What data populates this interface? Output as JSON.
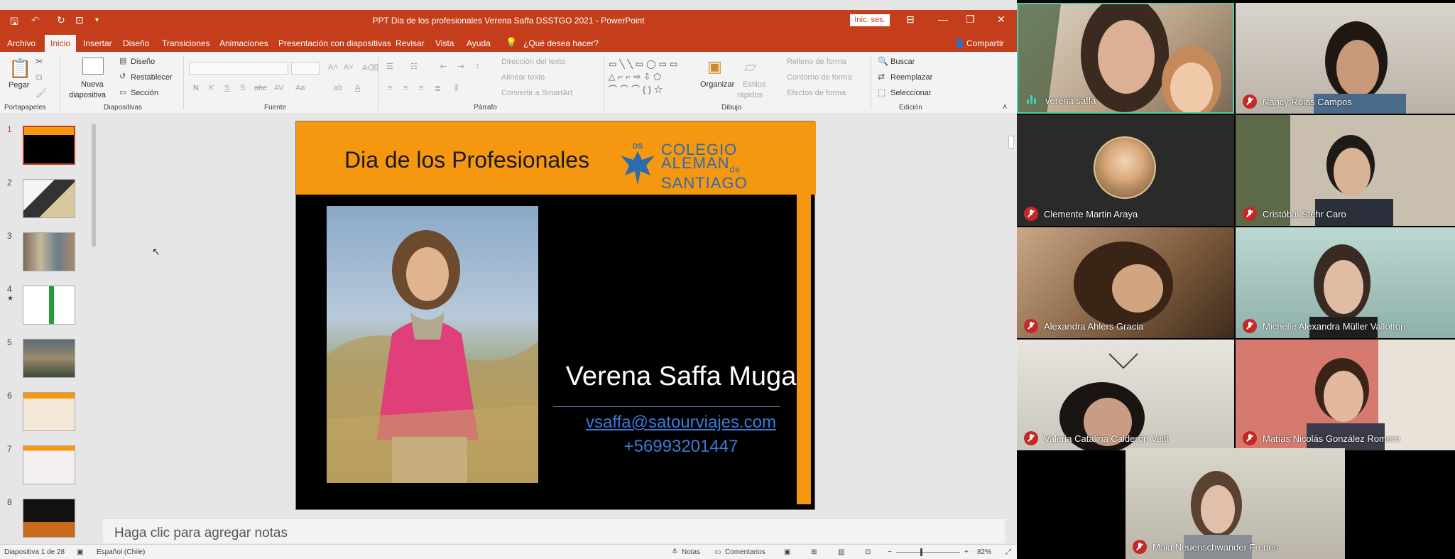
{
  "powerpoint": {
    "window_title": "PPT Dia de los profesionales Verena Saffa DSSTGO 2021  -  PowerPoint",
    "sign_in": "Inic. ses.",
    "tabs": [
      "Archivo",
      "Inicio",
      "Insertar",
      "Diseño",
      "Transiciones",
      "Animaciones",
      "Presentación con diapositivas",
      "Revisar",
      "Vista",
      "Ayuda",
      "¿Qué desea hacer?"
    ],
    "share": "Compartir",
    "ribbon": {
      "clipboard": {
        "paste": "Pegar",
        "group": "Portapapeles"
      },
      "slides": {
        "new_slide_1": "Nueva",
        "new_slide_2": "diapositiva",
        "layout": "Diseño",
        "reset": "Restablecer",
        "section": "Sección",
        "group": "Diapositivas"
      },
      "font": {
        "bold": "N",
        "italic": "K",
        "underline": "S",
        "shadow": "S",
        "strike": "abc",
        "group": "Fuente"
      },
      "paragraph": {
        "text_direction": "Dirección del texto",
        "align_text": "Alinear texto",
        "smartart": "Convertir a SmartArt",
        "group": "Párrafo"
      },
      "drawing": {
        "arrange": "Organizar",
        "quick_styles_1": "Estilos",
        "quick_styles_2": "rápidos",
        "shape_fill": "Relleno de forma",
        "shape_outline": "Contorno de forma",
        "shape_effects": "Efectos de forma",
        "group": "Dibujo"
      },
      "editing": {
        "find": "Buscar",
        "replace": "Reemplazar",
        "select": "Seleccionar",
        "group": "Edición"
      }
    },
    "thumbnails": [
      "1",
      "2",
      "3",
      "4",
      "5",
      "6",
      "7",
      "8"
    ],
    "slide": {
      "title": "Dia de los Profesionales",
      "logo_ds": "DS",
      "logo_line1": "COLEGIO",
      "logo_line2": "ALEMAN",
      "logo_de": "de",
      "logo_line3": "SANTIAGO",
      "name": "Verena Saffa Muga",
      "email": "vsaffa@satourviajes.com",
      "phone": "+56993201447"
    },
    "notes_placeholder": "Haga clic para agregar notas",
    "status": {
      "slide_count": "Diapositiva 1 de 28",
      "language": "Español (Chile)",
      "notes": "Notas",
      "comments": "Comentarios",
      "zoom": "82%"
    }
  },
  "participants": [
    {
      "name": "verena saffa",
      "muted": false,
      "bg": "#c9b29a"
    },
    {
      "name": "Nancy Rojas Campos",
      "muted": true,
      "bg": "#c8c2bb"
    },
    {
      "name": "Clemente Martin Araya",
      "muted": true,
      "bg": "#2a2a2a"
    },
    {
      "name": "Cristóbal Stehr Caro",
      "muted": true,
      "bg": "#b7ae9b"
    },
    {
      "name": "Alexandra Ahlers Gracia",
      "muted": true,
      "bg": "#8b6f52"
    },
    {
      "name": "Michelle Alexandra Müller Vallotton",
      "muted": true,
      "bg": "#a9c7c2"
    },
    {
      "name": "Valeria Catalina Calderón Veitl",
      "muted": true,
      "bg": "#cfcfc6"
    },
    {
      "name": "Matías Nicolás González Romero",
      "muted": true,
      "bg": "#c8746b"
    },
    {
      "name": "Maia Neuenschwander Fredes",
      "muted": true,
      "bg": "#c5c0b5"
    }
  ],
  "colors": {
    "ppt_accent": "#c43e1c",
    "slide_orange": "#f5970f",
    "link_blue": "#3a7bd5",
    "muted_red": "#c62828",
    "speaking_green": "#3bd6b4"
  }
}
